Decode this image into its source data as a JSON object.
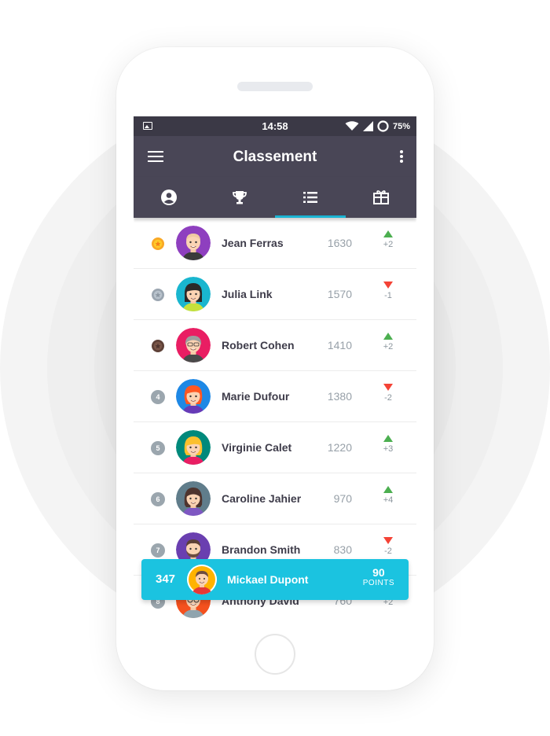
{
  "status_bar": {
    "time": "14:58",
    "battery": "75%"
  },
  "app_bar": {
    "title": "Classement",
    "menu_icon": "menu-icon",
    "more_icon": "more-vert-icon"
  },
  "tabs": [
    {
      "icon": "account-circle-icon",
      "active": false
    },
    {
      "icon": "trophy-icon",
      "active": false
    },
    {
      "icon": "list-icon",
      "active": true
    },
    {
      "icon": "gift-card-icon",
      "active": false
    }
  ],
  "leaderboard": [
    {
      "rank_badge": "gold-medal",
      "name": "Jean Ferras",
      "score": "1630",
      "direction": "up",
      "delta": "+2"
    },
    {
      "rank_badge": "silver-medal",
      "name": "Julia Link",
      "score": "1570",
      "direction": "down",
      "delta": "-1"
    },
    {
      "rank_badge": "bronze-medal",
      "name": "Robert Cohen",
      "score": "1410",
      "direction": "up",
      "delta": "+2"
    },
    {
      "rank": "4",
      "name": "Marie Dufour",
      "score": "1380",
      "direction": "down",
      "delta": "-2"
    },
    {
      "rank": "5",
      "name": "Virginie Calet",
      "score": "1220",
      "direction": "up",
      "delta": "+3"
    },
    {
      "rank": "6",
      "name": "Caroline Jahier",
      "score": "970",
      "direction": "up",
      "delta": "+4"
    },
    {
      "rank": "7",
      "name": "Brandon Smith",
      "score": "830",
      "direction": "down",
      "delta": "-2"
    },
    {
      "rank": "8",
      "name": "Anthony David",
      "score": "760",
      "direction": "up",
      "delta": "+2"
    }
  ],
  "current_user": {
    "rank": "347",
    "name": "Mickael Dupont",
    "points": "90",
    "points_label": "POINTS"
  },
  "colors": {
    "app_bar": "#494656",
    "status_bar": "#3b3946",
    "accent": "#1bc3e0",
    "up": "#4caf50",
    "down": "#f44336"
  }
}
